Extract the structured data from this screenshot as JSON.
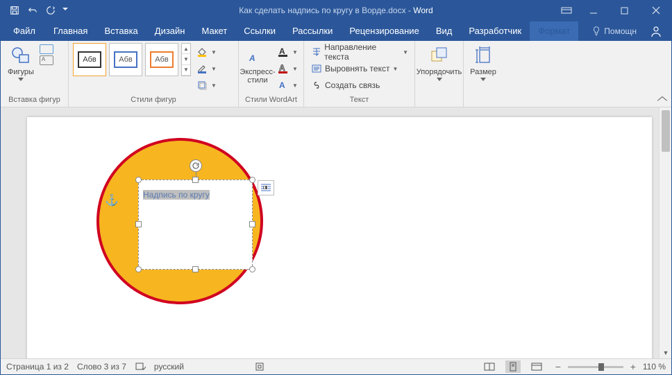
{
  "titlebar": {
    "doc_title": "Как сделать надпись по кругу в Ворде.docx",
    "app_name": "Word"
  },
  "tabs": {
    "file": "Файл",
    "home": "Главная",
    "insert": "Вставка",
    "design": "Дизайн",
    "layout": "Макет",
    "references": "Ссылки",
    "mailings": "Рассылки",
    "review": "Рецензирование",
    "view": "Вид",
    "developer": "Разработчик",
    "format": "Формат",
    "help": "Помощн"
  },
  "ribbon": {
    "shapes": {
      "label": "Фигуры",
      "group": "Вставка фигур"
    },
    "styles": {
      "sample": "Абв",
      "group": "Стили фигур"
    },
    "wordart": {
      "label": "Экспресс-\nстили",
      "group": "Стили WordArt"
    },
    "text": {
      "direction": "Направление текста",
      "align": "Выровнять текст",
      "link": "Создать связь",
      "group": "Текст"
    },
    "arrange": {
      "label": "Упорядочить"
    },
    "size": {
      "label": "Размер"
    }
  },
  "document": {
    "textbox_content": "Надпись по кругу"
  },
  "statusbar": {
    "page": "Страница 1 из 2",
    "words": "Слово 3 из 7",
    "language": "русский",
    "zoom": "110 %"
  }
}
